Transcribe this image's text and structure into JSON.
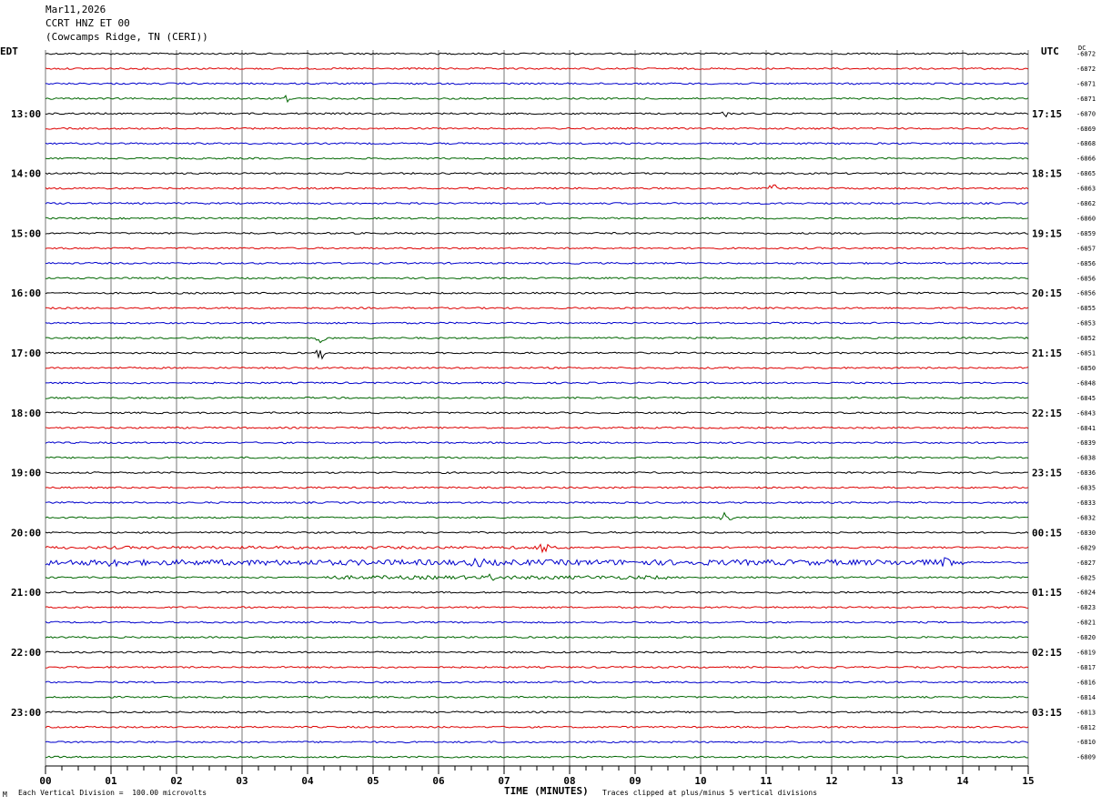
{
  "header": {
    "date": "Mar11,2026",
    "channel": "CCRT HNZ ET 00",
    "station": "(Cowcamps Ridge, TN (CERI))"
  },
  "left_tz": "EDT",
  "right_tz": "UTC",
  "dc_label": "DC",
  "footer": {
    "scale_note": "Each Vertical Division =  100.00 microvolts",
    "clip_note": "Traces clipped at plus/minus 5 vertical divisions",
    "x_title": "TIME (MINUTES)",
    "corner_mark": "M"
  },
  "colors": [
    "#000000",
    "#dd0000",
    "#0000cc",
    "#006600"
  ],
  "chart_data": {
    "type": "line",
    "title": "CCRT HNZ ET 00",
    "xlabel": "TIME (MINUTES)",
    "x_ticks": [
      "00",
      "01",
      "02",
      "03",
      "04",
      "05",
      "06",
      "07",
      "08",
      "09",
      "10",
      "11",
      "12",
      "13",
      "14",
      "15"
    ],
    "xlim": [
      0,
      15
    ],
    "left_hour_labels": [
      "13:00",
      "14:00",
      "15:00",
      "16:00",
      "17:00",
      "18:00",
      "19:00",
      "20:00",
      "21:00",
      "22:00",
      "23:00"
    ],
    "right_hour_labels": [
      "17:15",
      "18:15",
      "19:15",
      "20:15",
      "21:15",
      "22:15",
      "23:15",
      "00:15",
      "01:15",
      "02:15",
      "03:15"
    ],
    "dc_offsets": [
      "-6872",
      "-6872",
      "-6871",
      "-6871",
      "-6870",
      "-6869",
      "-6868",
      "-6866",
      "-6865",
      "-6863",
      "-6862",
      "-6860",
      "-6859",
      "-6857",
      "-6856",
      "-6856",
      "-6856",
      "-6855",
      "-6853",
      "-6852",
      "-6851",
      "-6850",
      "-6848",
      "-6845",
      "-6843",
      "-6841",
      "-6839",
      "-6838",
      "-6836",
      "-6835",
      "-6833",
      "-6832",
      "-6830",
      "-6829",
      "-6827",
      "-6825",
      "-6824",
      "-6823",
      "-6821",
      "-6820",
      "-6819",
      "-6817",
      "-6816",
      "-6814",
      "-6813",
      "-6812",
      "-6810",
      "-6809"
    ],
    "trace_count": 48,
    "trace_minutes_each": 15,
    "events": [
      {
        "trace": 3,
        "minute": 3.7,
        "amp": 5
      },
      {
        "trace": 4,
        "minute": 10.4,
        "amp": 4
      },
      {
        "trace": 5,
        "minute": 12.1,
        "amp": 3
      },
      {
        "trace": 9,
        "minute": 11.1,
        "amp": 5
      },
      {
        "trace": 19,
        "minute": 4.2,
        "amp": 6
      },
      {
        "trace": 20,
        "minute": 4.2,
        "amp": 8
      },
      {
        "trace": 31,
        "minute": 10.4,
        "amp": 8
      },
      {
        "trace": 33,
        "minute": 7.6,
        "amp": 7
      },
      {
        "trace": 34,
        "minute": 13.75,
        "amp": 8
      },
      {
        "trace": 34,
        "minute": 6.6,
        "amp": 6
      },
      {
        "trace": 34,
        "minute": 1.0,
        "amp": 5
      },
      {
        "trace": 35,
        "minute": 6.8,
        "amp": 4
      }
    ],
    "noisy_traces": [
      {
        "trace": 34,
        "from": 0,
        "to": 14,
        "amp": 3
      },
      {
        "trace": 35,
        "from": 4.2,
        "to": 9.5,
        "amp": 2
      },
      {
        "trace": 33,
        "from": 0,
        "to": 8,
        "amp": 1.5
      }
    ]
  }
}
